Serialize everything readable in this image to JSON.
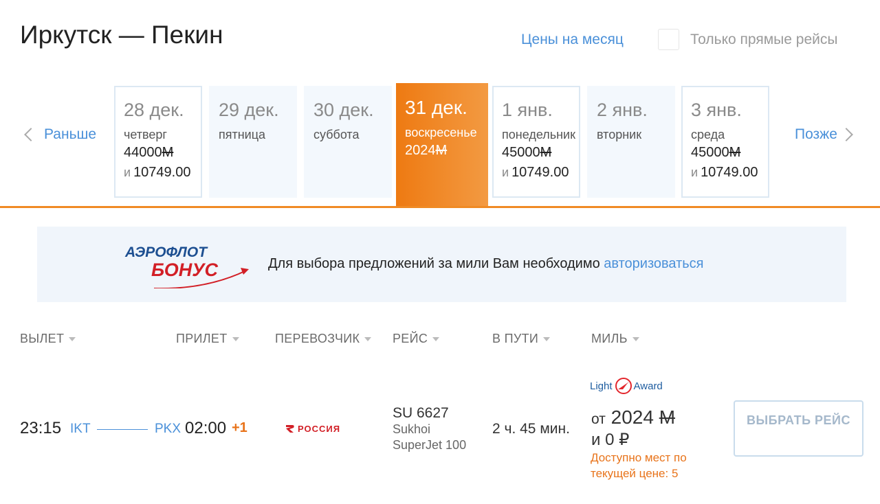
{
  "header": {
    "route_title": "Иркутск — Пекин",
    "month_prices_link": "Цены на месяц",
    "direct_only_label": "Только прямые рейсы",
    "direct_only_checked": false
  },
  "date_nav": {
    "prev_label": "Раньше",
    "next_label": "Позже",
    "days": [
      {
        "date": "28 дек.",
        "weekday": "четверг",
        "miles": "44000",
        "plus_prefix": "и",
        "plus_amount": "10749.00",
        "state": "available"
      },
      {
        "date": "29 дек.",
        "weekday": "пятница",
        "miles": "",
        "plus_prefix": "",
        "plus_amount": "",
        "state": "empty"
      },
      {
        "date": "30 дек.",
        "weekday": "суббота",
        "miles": "",
        "plus_prefix": "",
        "plus_amount": "",
        "state": "empty"
      },
      {
        "date": "31 дек.",
        "weekday": "воскресенье",
        "miles": "2024",
        "plus_prefix": "",
        "plus_amount": "",
        "state": "selected"
      },
      {
        "date": "1 янв.",
        "weekday": "понедельник",
        "miles": "45000",
        "plus_prefix": "и",
        "plus_amount": "10749.00",
        "state": "available"
      },
      {
        "date": "2 янв.",
        "weekday": "вторник",
        "miles": "",
        "plus_prefix": "",
        "plus_amount": "",
        "state": "empty"
      },
      {
        "date": "3 янв.",
        "weekday": "среда",
        "miles": "45000",
        "plus_prefix": "и",
        "plus_amount": "10749.00",
        "state": "available"
      }
    ],
    "miles_symbol": "М"
  },
  "banner": {
    "logo_line1": "АЭРОФЛОТ",
    "logo_line2": "БОНУС",
    "text": "Для выбора предложений за мили Вам необходимо ",
    "link": "авторизоваться"
  },
  "columns": [
    "ВЫЛЕТ",
    "ПРИЛЕТ",
    "ПЕРЕВОЗЧИК",
    "РЕЙС",
    "В ПУТИ",
    "МИЛЬ"
  ],
  "flight": {
    "departure_time": "23:15",
    "departure_code": "IKT",
    "arrival_code": "PKX",
    "arrival_time": "02:00",
    "day_offset": "+1",
    "carrier_name": "РОССИЯ",
    "flight_number": "SU 6627",
    "aircraft_line1": "Sukhoi",
    "aircraft_line2": "SuperJet 100",
    "duration": "2 ч. 45 мин.",
    "fare_brand_left": "Light",
    "fare_brand_right": "Award",
    "price_prefix": "от",
    "price_miles": "2024",
    "price_miles_symbol": "М",
    "price_plus_prefix": "и",
    "price_plus_amount": "0",
    "currency_symbol": "₽",
    "seats_note": "Доступно мест по текущей цене: 5",
    "select_button": "ВЫБРАТЬ РЕЙС"
  },
  "colors": {
    "accent_orange": "#f08a24",
    "link_blue": "#4a90d9",
    "aeroflot_red": "#d21f26"
  }
}
